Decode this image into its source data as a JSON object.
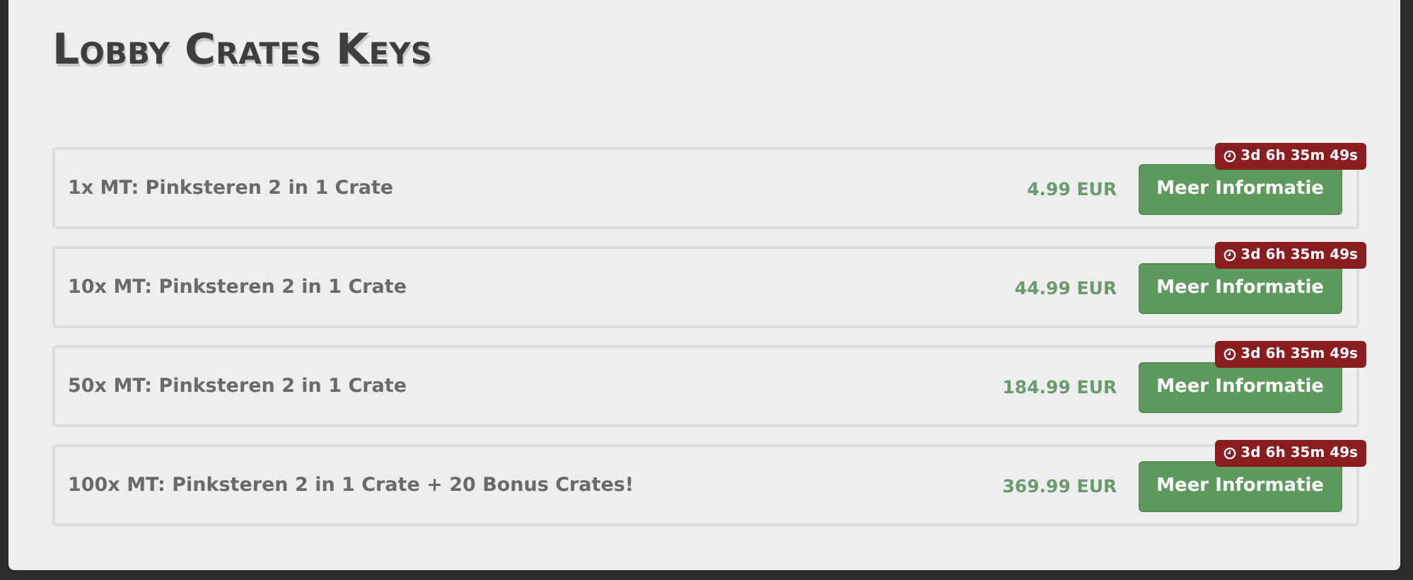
{
  "title": "Lobby Crates Keys",
  "items": [
    {
      "name": "1x MT: Pinksteren 2 in 1 Crate",
      "price": "4.99 EUR",
      "button": "Meer Informatie",
      "timer": "3d 6h 35m 49s"
    },
    {
      "name": "10x MT: Pinksteren 2 in 1 Crate",
      "price": "44.99 EUR",
      "button": "Meer Informatie",
      "timer": "3d 6h 35m 49s"
    },
    {
      "name": "50x MT: Pinksteren 2 in 1 Crate",
      "price": "184.99 EUR",
      "button": "Meer Informatie",
      "timer": "3d 6h 35m 49s"
    },
    {
      "name": "100x MT: Pinksteren 2 in 1 Crate + 20 Bonus Crates!",
      "price": "369.99 EUR",
      "button": "Meer Informatie",
      "timer": "3d 6h 35m 49s"
    }
  ]
}
